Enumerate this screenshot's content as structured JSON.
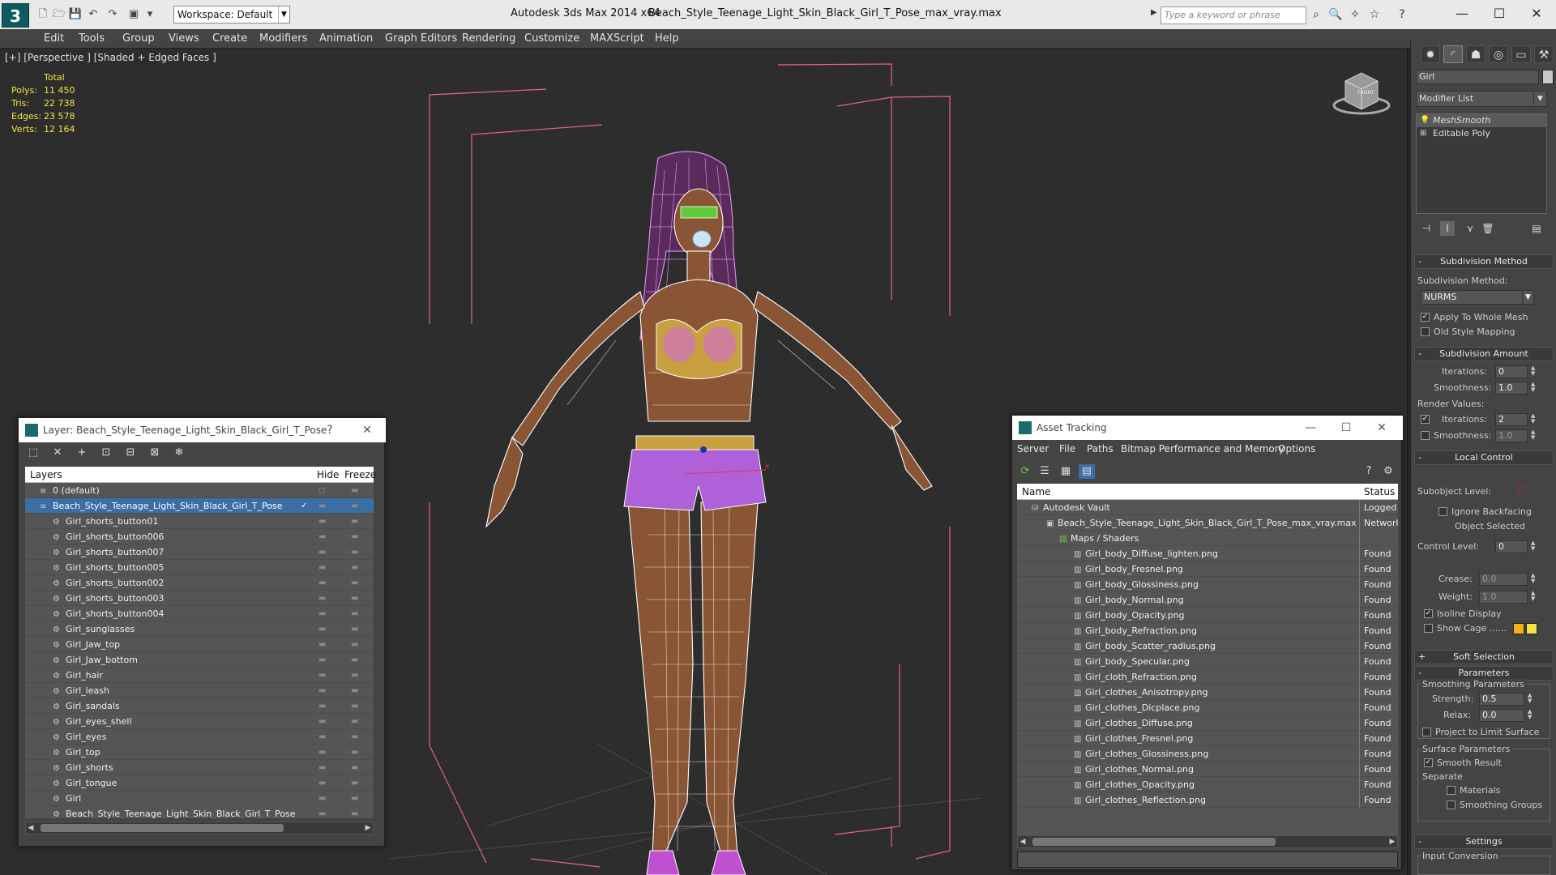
{
  "app": {
    "title": "Autodesk 3ds Max  2014 x64",
    "file": "Beach_Style_Teenage_Light_Skin_Black_Girl_T_Pose_max_vray.max",
    "logo": "3"
  },
  "toolbar": {
    "workspace": "Workspace: Default",
    "search_placeholder": "Type a keyword or phrase"
  },
  "menu": [
    "Edit",
    "Tools",
    "Group",
    "Views",
    "Create",
    "Modifiers",
    "Animation",
    "Graph Editors",
    "Rendering",
    "Customize",
    "MAXScript",
    "Help"
  ],
  "viewport": {
    "label": "[+] [Perspective ] [Shaded + Edged Faces ]",
    "stats": {
      "header": "Total",
      "rows": [
        {
          "label": "Polys:",
          "value": "11 450"
        },
        {
          "label": "Tris:",
          "value": "22 738"
        },
        {
          "label": "Edges:",
          "value": "23 578"
        },
        {
          "label": "Verts:",
          "value": "12 164"
        }
      ]
    },
    "viewcube_label": "FRONT"
  },
  "command_panel": {
    "object_name": "Girl",
    "modifier_list": "Modifier List",
    "stack": [
      "MeshSmooth",
      "Editable Poly"
    ],
    "subdivision_method": {
      "title": "Subdivision Method",
      "label": "Subdivision Method:",
      "value": "NURMS",
      "apply_whole": "Apply To Whole Mesh",
      "old_style": "Old Style Mapping"
    },
    "subdivision_amount": {
      "title": "Subdivision Amount",
      "iterations_label": "Iterations:",
      "iterations": "0",
      "smoothness_label": "Smoothness:",
      "smoothness": "1.0",
      "render_values": "Render Values:",
      "r_iterations_label": "Iterations:",
      "r_iterations": "2",
      "r_smoothness_label": "Smoothness:",
      "r_smoothness": "1.0"
    },
    "local_control": {
      "title": "Local Control",
      "subobject_level": "Subobject Level:",
      "ignore_backfacing": "Ignore Backfacing",
      "object_selected": "Object Selected",
      "control_level_label": "Control Level:",
      "control_level": "0",
      "crease_label": "Crease:",
      "crease": "0.0",
      "weight_label": "Weight:",
      "weight": "1.0",
      "isoline": "Isoline Display",
      "show_cage": "Show Cage ......"
    },
    "soft_selection": "Soft Selection",
    "parameters": {
      "title": "Parameters",
      "smoothing_params": "Smoothing Parameters",
      "strength_label": "Strength:",
      "strength": "0.5",
      "relax_label": "Relax:",
      "relax": "0.0",
      "project": "Project to Limit Surface",
      "surface_params": "Surface Parameters",
      "smooth_result": "Smooth Result",
      "separate": "Separate",
      "materials": "Materials",
      "smoothing_groups": "Smoothing Groups"
    },
    "settings": {
      "title": "Settings",
      "input_conversion": "Input Conversion"
    }
  },
  "layers_panel": {
    "title": "Layer: Beach_Style_Teenage_Light_Skin_Black_Girl_T_Pose",
    "help": "?",
    "close": "✕",
    "columns": {
      "layers": "Layers",
      "hide": "Hide",
      "freeze": "Freeze"
    },
    "rows": [
      "0 (default)",
      "Beach_Style_Teenage_Light_Skin_Black_Girl_T_Pose",
      "Girl_shorts_button01",
      "Girl_shorts_button006",
      "Girl_shorts_button007",
      "Girl_shorts_button005",
      "Girl_shorts_button002",
      "Girl_shorts_button003",
      "Girl_shorts_button004",
      "Girl_sunglasses",
      "Girl_Jaw_top",
      "Girl_Jaw_bottom",
      "Girl_hair",
      "Girl_leash",
      "Girl_sandals",
      "Girl_eyes_shell",
      "Girl_eyes",
      "Girl_top",
      "Girl_shorts",
      "Girl_tongue",
      "Girl",
      "Beach_Style_Teenage_Light_Skin_Black_Girl_T_Pose"
    ]
  },
  "asset_panel": {
    "title": "Asset Tracking",
    "menu": [
      "Server",
      "File",
      "Paths",
      "Bitmap Performance and Memory",
      "Options"
    ],
    "columns": {
      "name": "Name",
      "status": "Status"
    },
    "rows": [
      {
        "name": "Autodesk Vault",
        "status": "Logged O"
      },
      {
        "name": "Beach_Style_Teenage_Light_Skin_Black_Girl_T_Pose_max_vray.max",
        "status": "Network"
      },
      {
        "name": "Maps / Shaders",
        "status": ""
      },
      {
        "name": "Girl_body_Diffuse_lighten.png",
        "status": "Found"
      },
      {
        "name": "Girl_body_Fresnel.png",
        "status": "Found"
      },
      {
        "name": "Girl_body_Glossiness.png",
        "status": "Found"
      },
      {
        "name": "Girl_body_Normal.png",
        "status": "Found"
      },
      {
        "name": "Girl_body_Opacity.png",
        "status": "Found"
      },
      {
        "name": "Girl_body_Refraction.png",
        "status": "Found"
      },
      {
        "name": "Girl_body_Scatter_radius.png",
        "status": "Found"
      },
      {
        "name": "Girl_body_Specular.png",
        "status": "Found"
      },
      {
        "name": "Girl_cloth_Refraction.png",
        "status": "Found"
      },
      {
        "name": "Girl_clothes_Anisotropy.png",
        "status": "Found"
      },
      {
        "name": "Girl_clothes_Dicplace.png",
        "status": "Found"
      },
      {
        "name": "Girl_clothes_Diffuse.png",
        "status": "Found"
      },
      {
        "name": "Girl_clothes_Fresnel.png",
        "status": "Found"
      },
      {
        "name": "Girl_clothes_Glossiness.png",
        "status": "Found"
      },
      {
        "name": "Girl_clothes_Normal.png",
        "status": "Found"
      },
      {
        "name": "Girl_clothes_Opacity.png",
        "status": "Found"
      },
      {
        "name": "Girl_clothes_Reflection.png",
        "status": "Found"
      }
    ]
  },
  "colors": {
    "accent": "#3a6ea5",
    "wire": "#ffffff",
    "bbox": "#e6609a",
    "stats": "#f4e342",
    "skin": "#8a5534",
    "cloth": "#b060d8"
  }
}
